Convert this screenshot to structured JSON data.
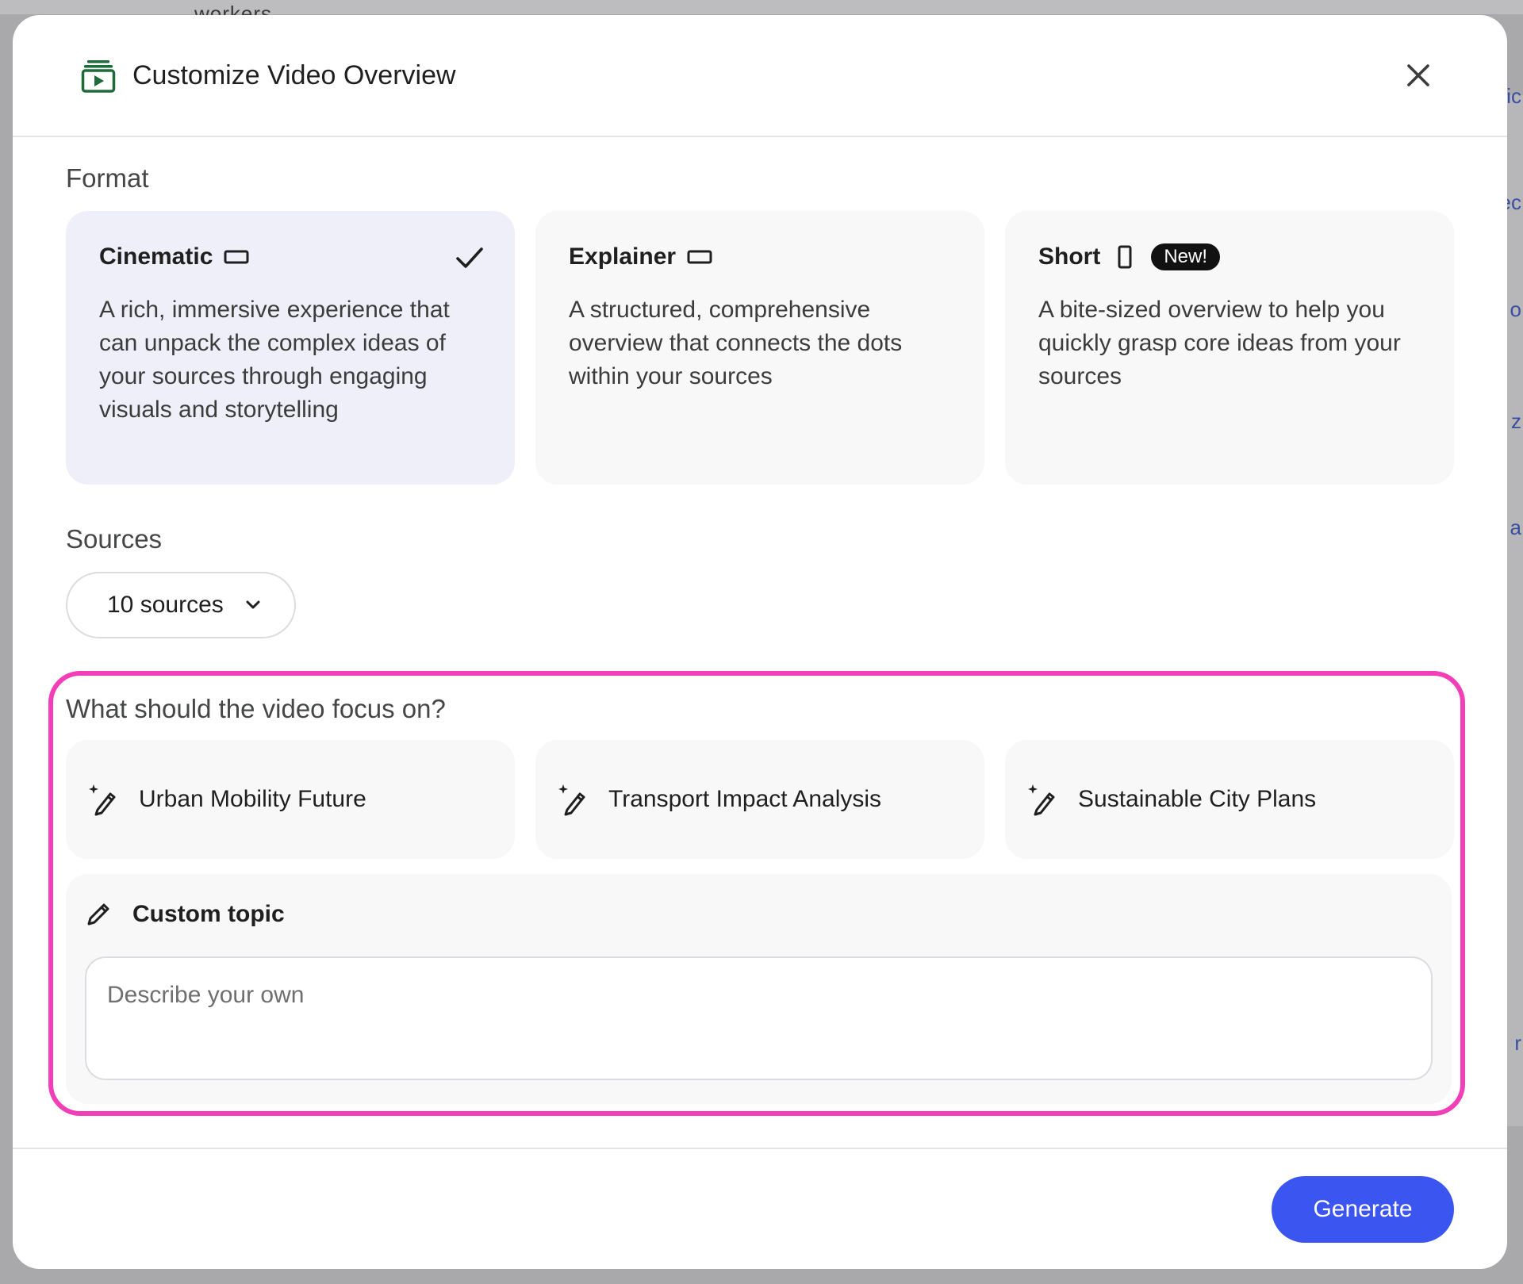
{
  "background": {
    "partial_text": "workers",
    "right_edge_chars": [
      "lic",
      "ec",
      "o",
      "z",
      "a",
      "r"
    ]
  },
  "dialog": {
    "title": "Customize Video Overview",
    "header_icon": "video-overview-icon",
    "close_icon": "close-icon"
  },
  "format": {
    "label": "Format",
    "options": [
      {
        "name": "Cinematic",
        "orientation_icon": "landscape-icon",
        "selected": true,
        "description": "A rich, immersive experience that can unpack the complex ideas of your sources through engaging visuals and storytelling"
      },
      {
        "name": "Explainer",
        "orientation_icon": "landscape-icon",
        "selected": false,
        "description": "A structured, comprehensive overview that connects the dots within your sources"
      },
      {
        "name": "Short",
        "orientation_icon": "portrait-icon",
        "badge": "New!",
        "selected": false,
        "description": "A bite-sized overview to help you quickly grasp core ideas from your sources"
      }
    ]
  },
  "sources": {
    "label": "Sources",
    "selected": "10 sources"
  },
  "focus": {
    "label": "What should the video focus on?",
    "suggestions": [
      "Urban Mobility Future",
      "Transport Impact Analysis",
      "Sustainable City Plans"
    ],
    "custom_label": "Custom topic",
    "custom_placeholder": "Describe your own"
  },
  "footer": {
    "generate_label": "Generate"
  },
  "colors": {
    "accent": "#3b55f0",
    "highlight_border": "#f33fb7",
    "selected_card": "#eeeff9",
    "icon_green": "#1e6b3a"
  }
}
